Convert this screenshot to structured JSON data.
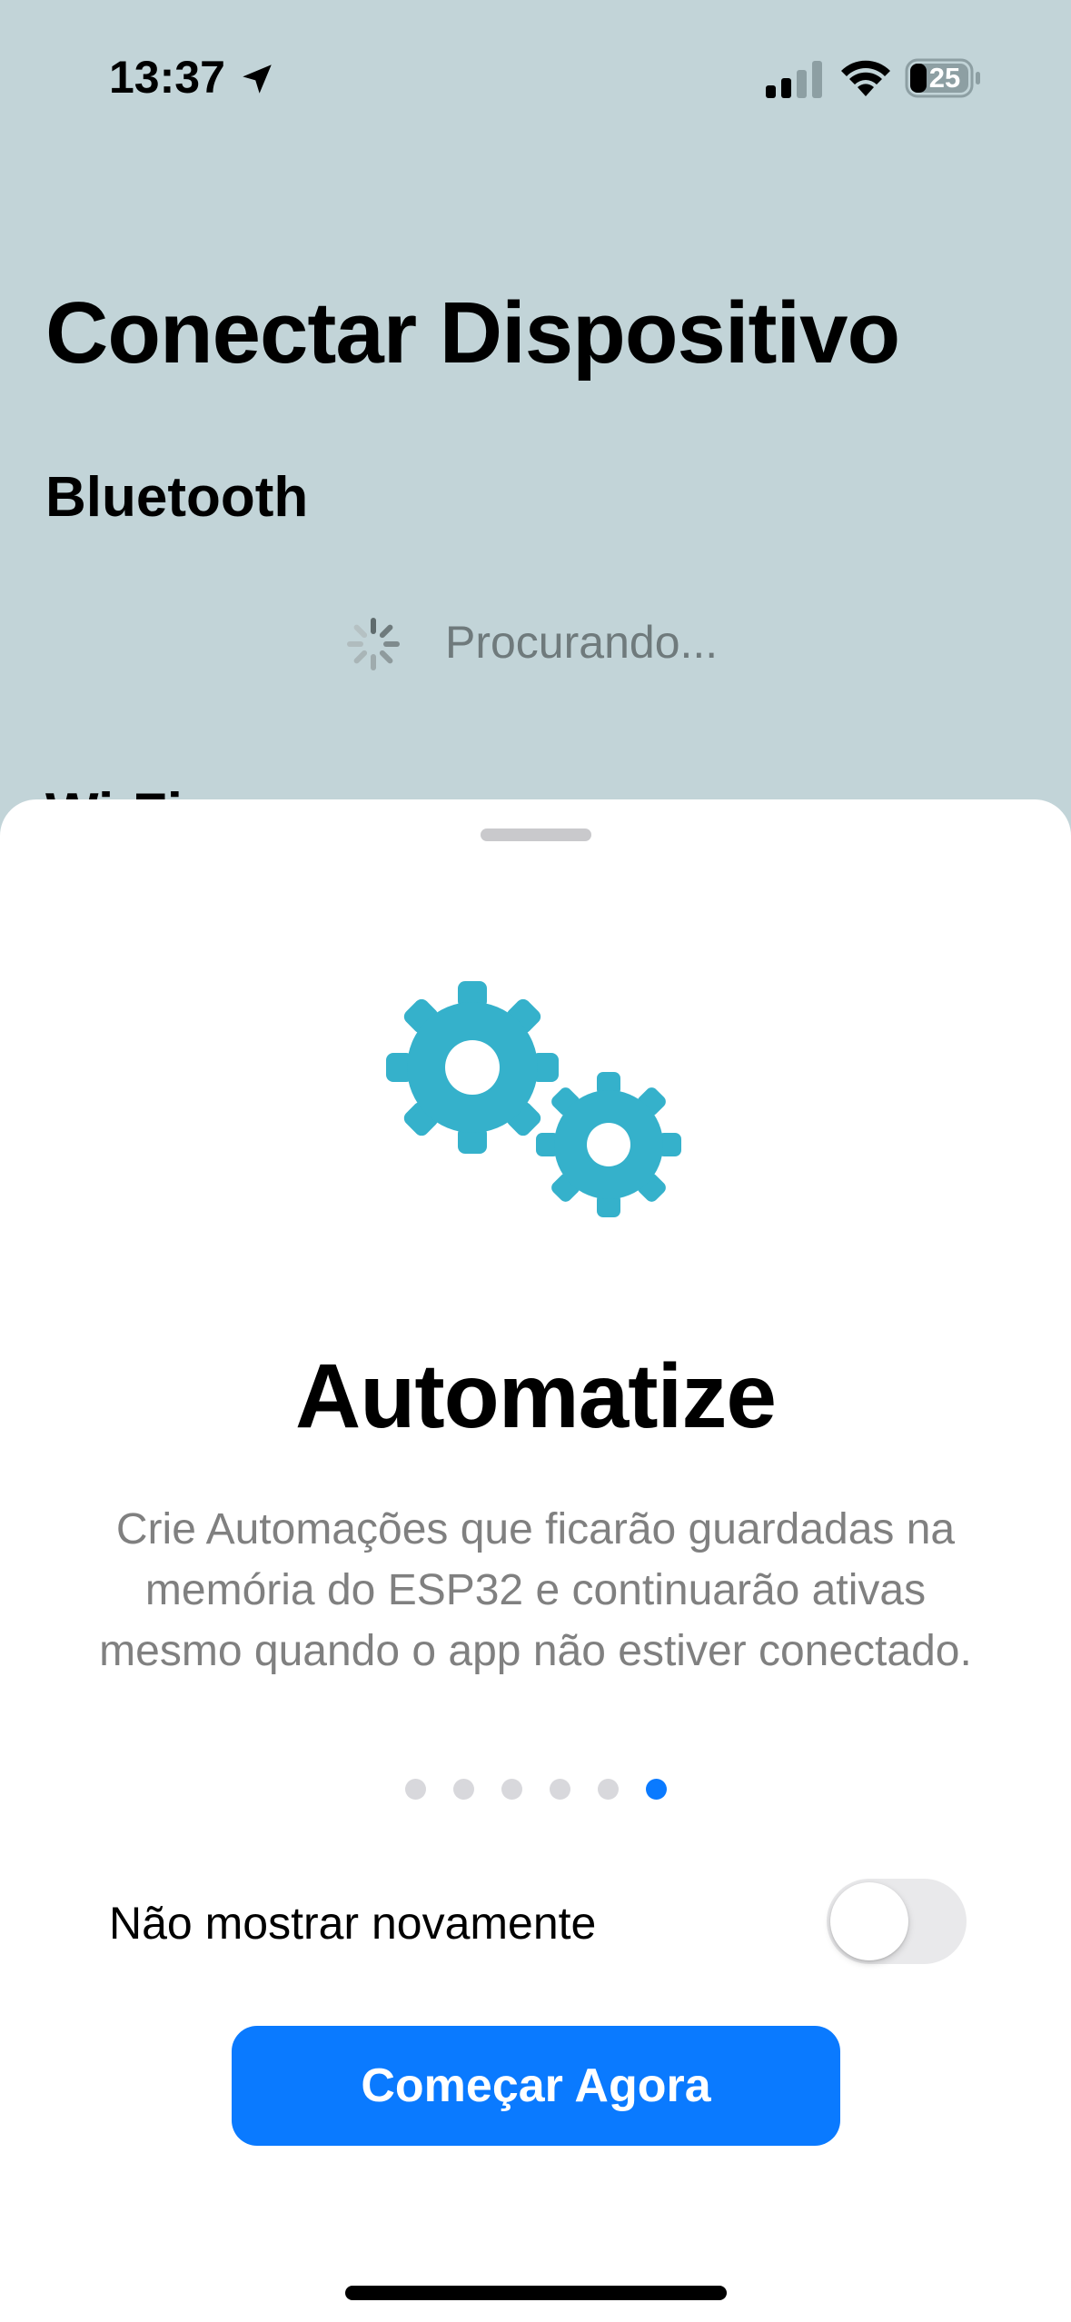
{
  "status_bar": {
    "time": "13:37",
    "battery": "25"
  },
  "background_page": {
    "title": "Conectar Dispositivo",
    "section_bluetooth": "Bluetooth",
    "searching_text": "Procurando...",
    "section_wifi": "Wi-Fi"
  },
  "onboarding": {
    "icon": "gears-icon",
    "title": "Automatize",
    "description": "Crie Automações que ficarão guardadas na memória do ESP32 e continuarão ativas mesmo quando o app não estiver conectado.",
    "page_count": 6,
    "current_page": 6,
    "dont_show_again_label": "Não mostrar novamente",
    "dont_show_again_on": false,
    "start_button_label": "Começar Agora"
  },
  "colors": {
    "accent": "#0a7aff",
    "gear": "#35b1cb",
    "background_tint": "#c2d4d8"
  }
}
